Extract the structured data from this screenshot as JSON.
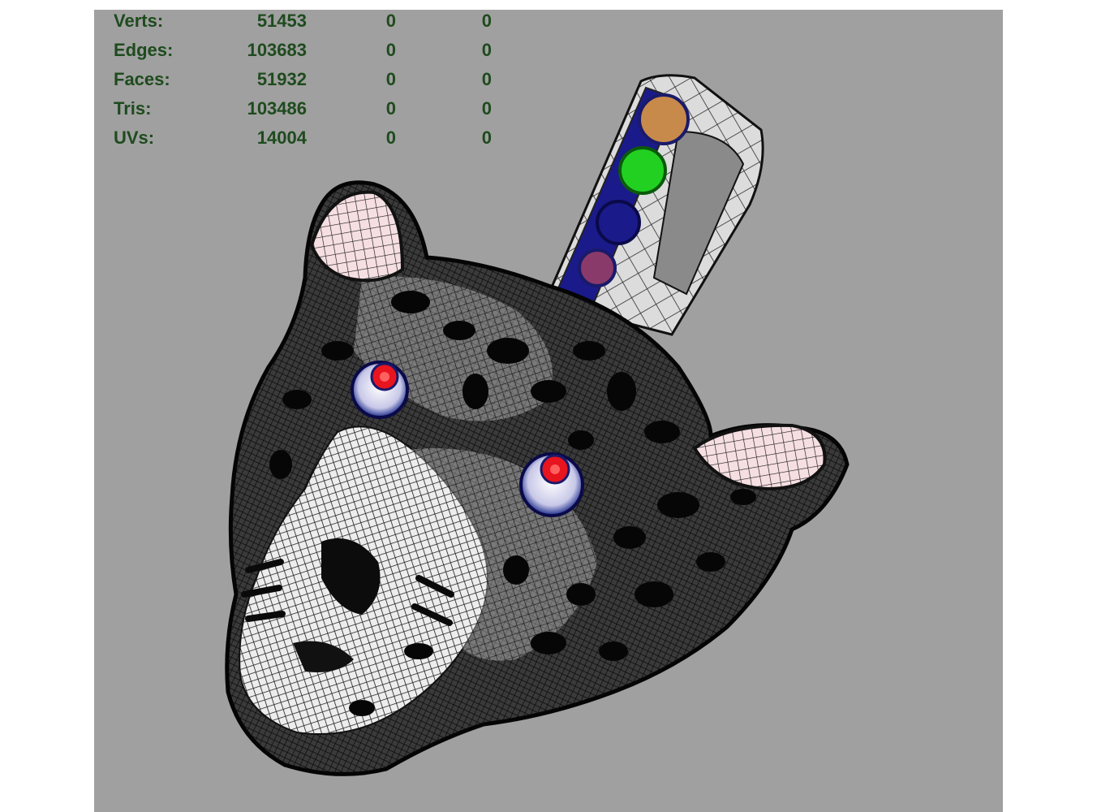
{
  "hud": {
    "rows": [
      {
        "label": "Verts:",
        "total": "51453",
        "selected": "0",
        "extra": "0"
      },
      {
        "label": "Edges:",
        "total": "103683",
        "selected": "0",
        "extra": "0"
      },
      {
        "label": "Faces:",
        "total": "51932",
        "selected": "0",
        "extra": "0"
      },
      {
        "label": "Tris:",
        "total": "103486",
        "selected": "0",
        "extra": "0"
      },
      {
        "label": "UVs:",
        "total": "14004",
        "selected": "0",
        "extra": "0"
      }
    ]
  },
  "colors": {
    "viewport_bg": "#a0a0a0",
    "hud_text": "#1e4b1e",
    "eye_gem": "#e8141e",
    "eye_setting": "#1a2a8a",
    "bail_gem_orange": "#c88a4a",
    "bail_gem_green": "#22d022",
    "bail_gem_blue": "#1a1a8a",
    "bail_gem_purple": "#8a3a6a",
    "ear_inner": "#f5dce0"
  },
  "icons": [
    "jaguar-pendant-wireframe-model"
  ]
}
